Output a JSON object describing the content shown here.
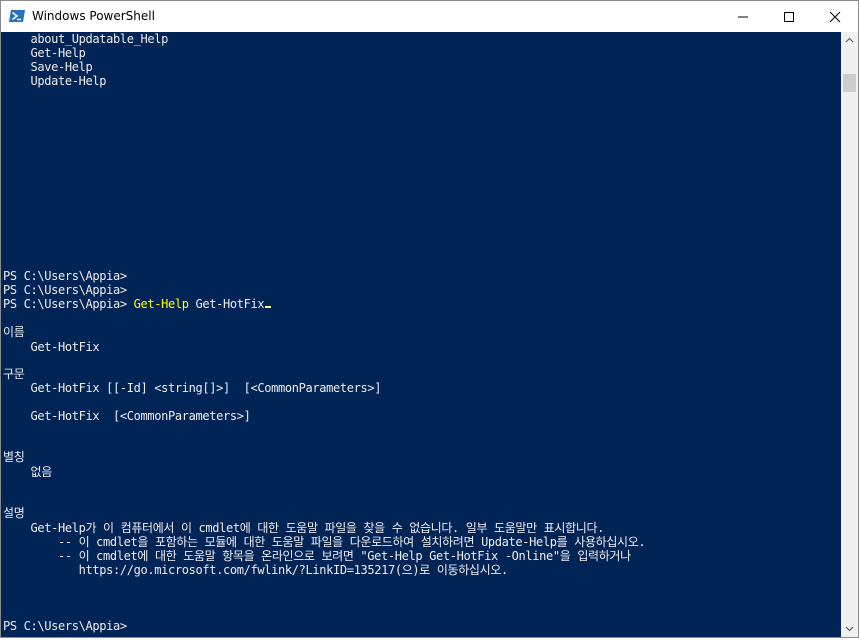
{
  "window": {
    "title": "Windows PowerShell"
  },
  "icons": {
    "app": "powershell-icon",
    "minimize": "minimize-icon",
    "maximize": "maximize-icon",
    "close": "close-icon"
  },
  "colors": {
    "console_bg": "#012456",
    "console_fg": "#eeedf0",
    "command_highlight": "#ffff00"
  },
  "console": {
    "lines": [
      "    about_Updatable_Help",
      "    Get-Help",
      "    Save-Help",
      "    Update-Help",
      "PS C:\\Users\\Appia>",
      "PS C:\\Users\\Appia>",
      "PS C:\\Users\\Appia>",
      "이름",
      "    Get-HotFix",
      "구문",
      "    Get-HotFix [[-Id] <string[]>]  [<CommonParameters>]",
      "    Get-HotFix  [<CommonParameters>]",
      "별칭",
      "    없음",
      "설명",
      "    Get-Help가 이 컴퓨터에서 이 cmdlet에 대한 도움말 파일을 찾을 수 없습니다. 일부 도움말만 표시합니다.",
      "        -- 이 cmdlet을 포함하는 모듈에 대한 도움말 파일을 다운로드하여 설치하려면 Update-Help를 사용하십시오.",
      "        -- 이 cmdlet에 대한 도움말 항목을 온라인으로 보려면 \"Get-Help Get-HotFix -Online\"을 입력하거나",
      "           https://go.microsoft.com/fwlink/?LinkID=135217(으)로 이동하십시오.",
      "PS C:\\Users\\Appia>"
    ],
    "command": {
      "cmdlet": "Get-Help",
      "argument": " Get-HotFix"
    }
  }
}
